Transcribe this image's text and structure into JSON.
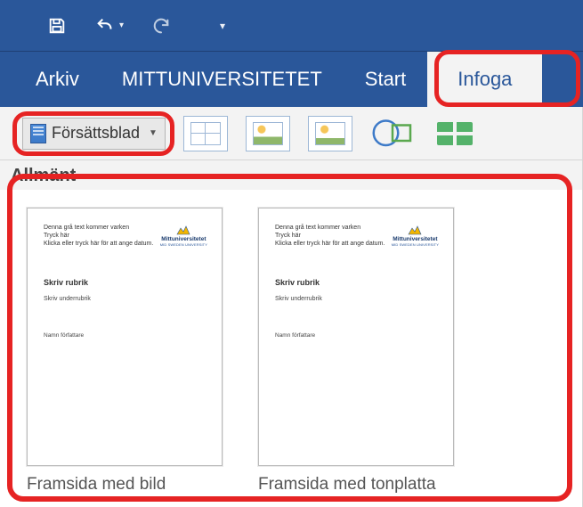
{
  "qat": {
    "save": "save",
    "undo": "undo",
    "redo": "redo",
    "customize": "customize"
  },
  "tabs": {
    "arkiv": "Arkiv",
    "custom": "MITTUNIVERSITETET",
    "start": "Start",
    "infoga": "Infoga"
  },
  "ribbon": {
    "forsattsblad_label": "Försättsblad"
  },
  "gallery": {
    "heading": "Allmänt",
    "items": [
      {
        "label": "Framsida med bild"
      },
      {
        "label": "Framsida med tonplatta"
      }
    ],
    "thumb": {
      "header_line1": "Denna grå text kommer varken",
      "header_line2": "Tryck här",
      "header_line3": "Klicka eller tryck här för att ange datum.",
      "logo_main": "Mittuniversitetet",
      "logo_sub": "MID SWEDEN UNIVERSITY",
      "title": "Skriv rubrik",
      "subtitle": "Skriv underrubrik",
      "footer": "Namn författare"
    }
  },
  "highlights": {
    "infoga_ring": true,
    "forsattsblad_ring": true,
    "gallery_ring": true
  }
}
